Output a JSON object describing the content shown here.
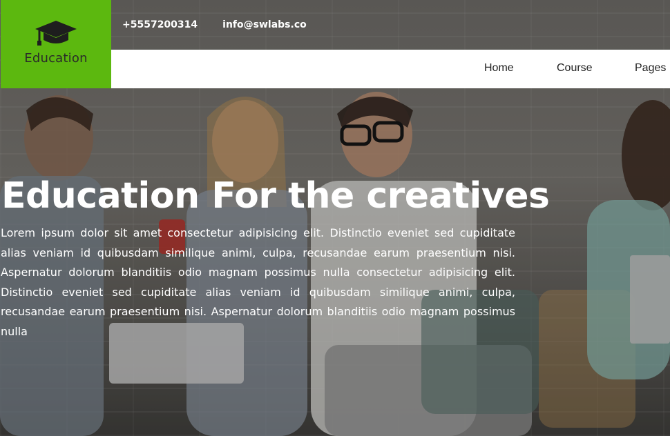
{
  "brand": {
    "name": "Education",
    "accent_color": "#5cb80f",
    "icon": "graduation-cap-icon"
  },
  "contact": {
    "phone": "+5557200314",
    "email": "info@swlabs.co"
  },
  "nav": {
    "items": [
      {
        "label": "Home"
      },
      {
        "label": "Course"
      },
      {
        "label": "Pages"
      }
    ]
  },
  "hero": {
    "title": "Education For the creatives",
    "text": "Lorem ipsum dolor sit amet consectetur adipisicing elit. Distinctio eveniet sed cupiditate alias veniam id quibusdam similique animi, culpa, recusandae earum praesentium nisi. Aspernatur dolorum blanditiis odio magnam possimus nulla consectetur adipisicing elit. Distinctio eveniet sed cupiditate alias veniam id quibusdam similique animi, culpa, recusandae earum praesentium nisi. Aspernatur dolorum blanditiis odio magnam possimus nulla"
  }
}
